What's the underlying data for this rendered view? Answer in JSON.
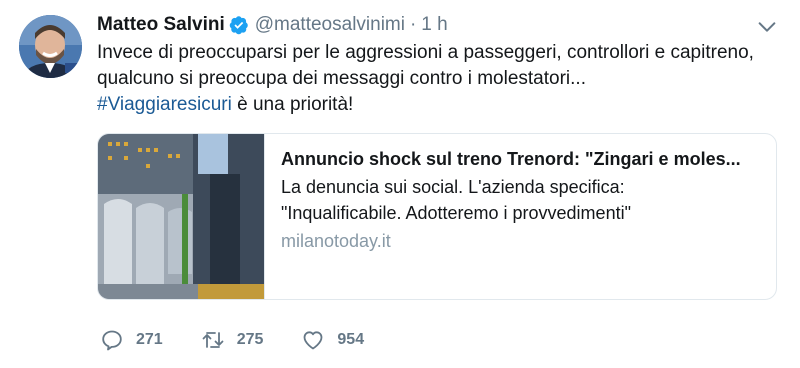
{
  "tweet": {
    "author_name": "Matteo Salvini",
    "handle": "@matteosalvinimi",
    "separator": "·",
    "time": "1 h",
    "text_line_1": "Invece di preoccuparsi per le aggressioni a passeggeri, controllori e capitreno,",
    "text_line_2": "qualcuno si preoccupa dei messaggi contro i molestatori...",
    "hashtag": "#Viaggiaresicuri",
    "text_line_3_rest": " è una priorità!"
  },
  "card": {
    "title": "Annuncio shock sul treno Trenord: \"Zingari e moles...",
    "description_line_1": "La denuncia sui social. L'azienda specifica:",
    "description_line_2": "\"Inqualificabile. Adotteremo i provvedimenti\"",
    "domain": "milanotoday.it"
  },
  "actions": {
    "replies": "271",
    "retweets": "275",
    "likes": "954"
  },
  "icons": {
    "verified": "verified-badge-icon",
    "caret": "chevron-down-icon",
    "reply": "reply-icon",
    "retweet": "retweet-icon",
    "like": "heart-icon"
  },
  "colors": {
    "verified_blue": "#1da1f2",
    "hashtag_blue": "#1b5a95",
    "muted_gray": "#657786"
  }
}
